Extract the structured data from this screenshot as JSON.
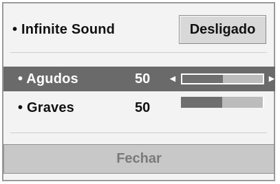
{
  "menu": {
    "infinite_sound": {
      "label": "• Infinite Sound",
      "button_label": "Desligado"
    },
    "treble": {
      "label": "• Agudos",
      "value": "50",
      "level_fraction": 0.5,
      "selected": true
    },
    "bass": {
      "label": "• Graves",
      "value": "50",
      "level_fraction": 0.5,
      "selected": false
    },
    "close_button_label": "Fechar"
  },
  "icons": {
    "left_arrow": "◄",
    "right_arrow": "►"
  },
  "colors": {
    "panel_bg": "#f3f3f3",
    "selected_row_bg": "#6a6a6a",
    "slider_dark": "#6f6f6f",
    "slider_light": "#bcbcbc",
    "button_bg": "#d8d8d8",
    "disabled_button_bg": "#c8c8c8"
  }
}
